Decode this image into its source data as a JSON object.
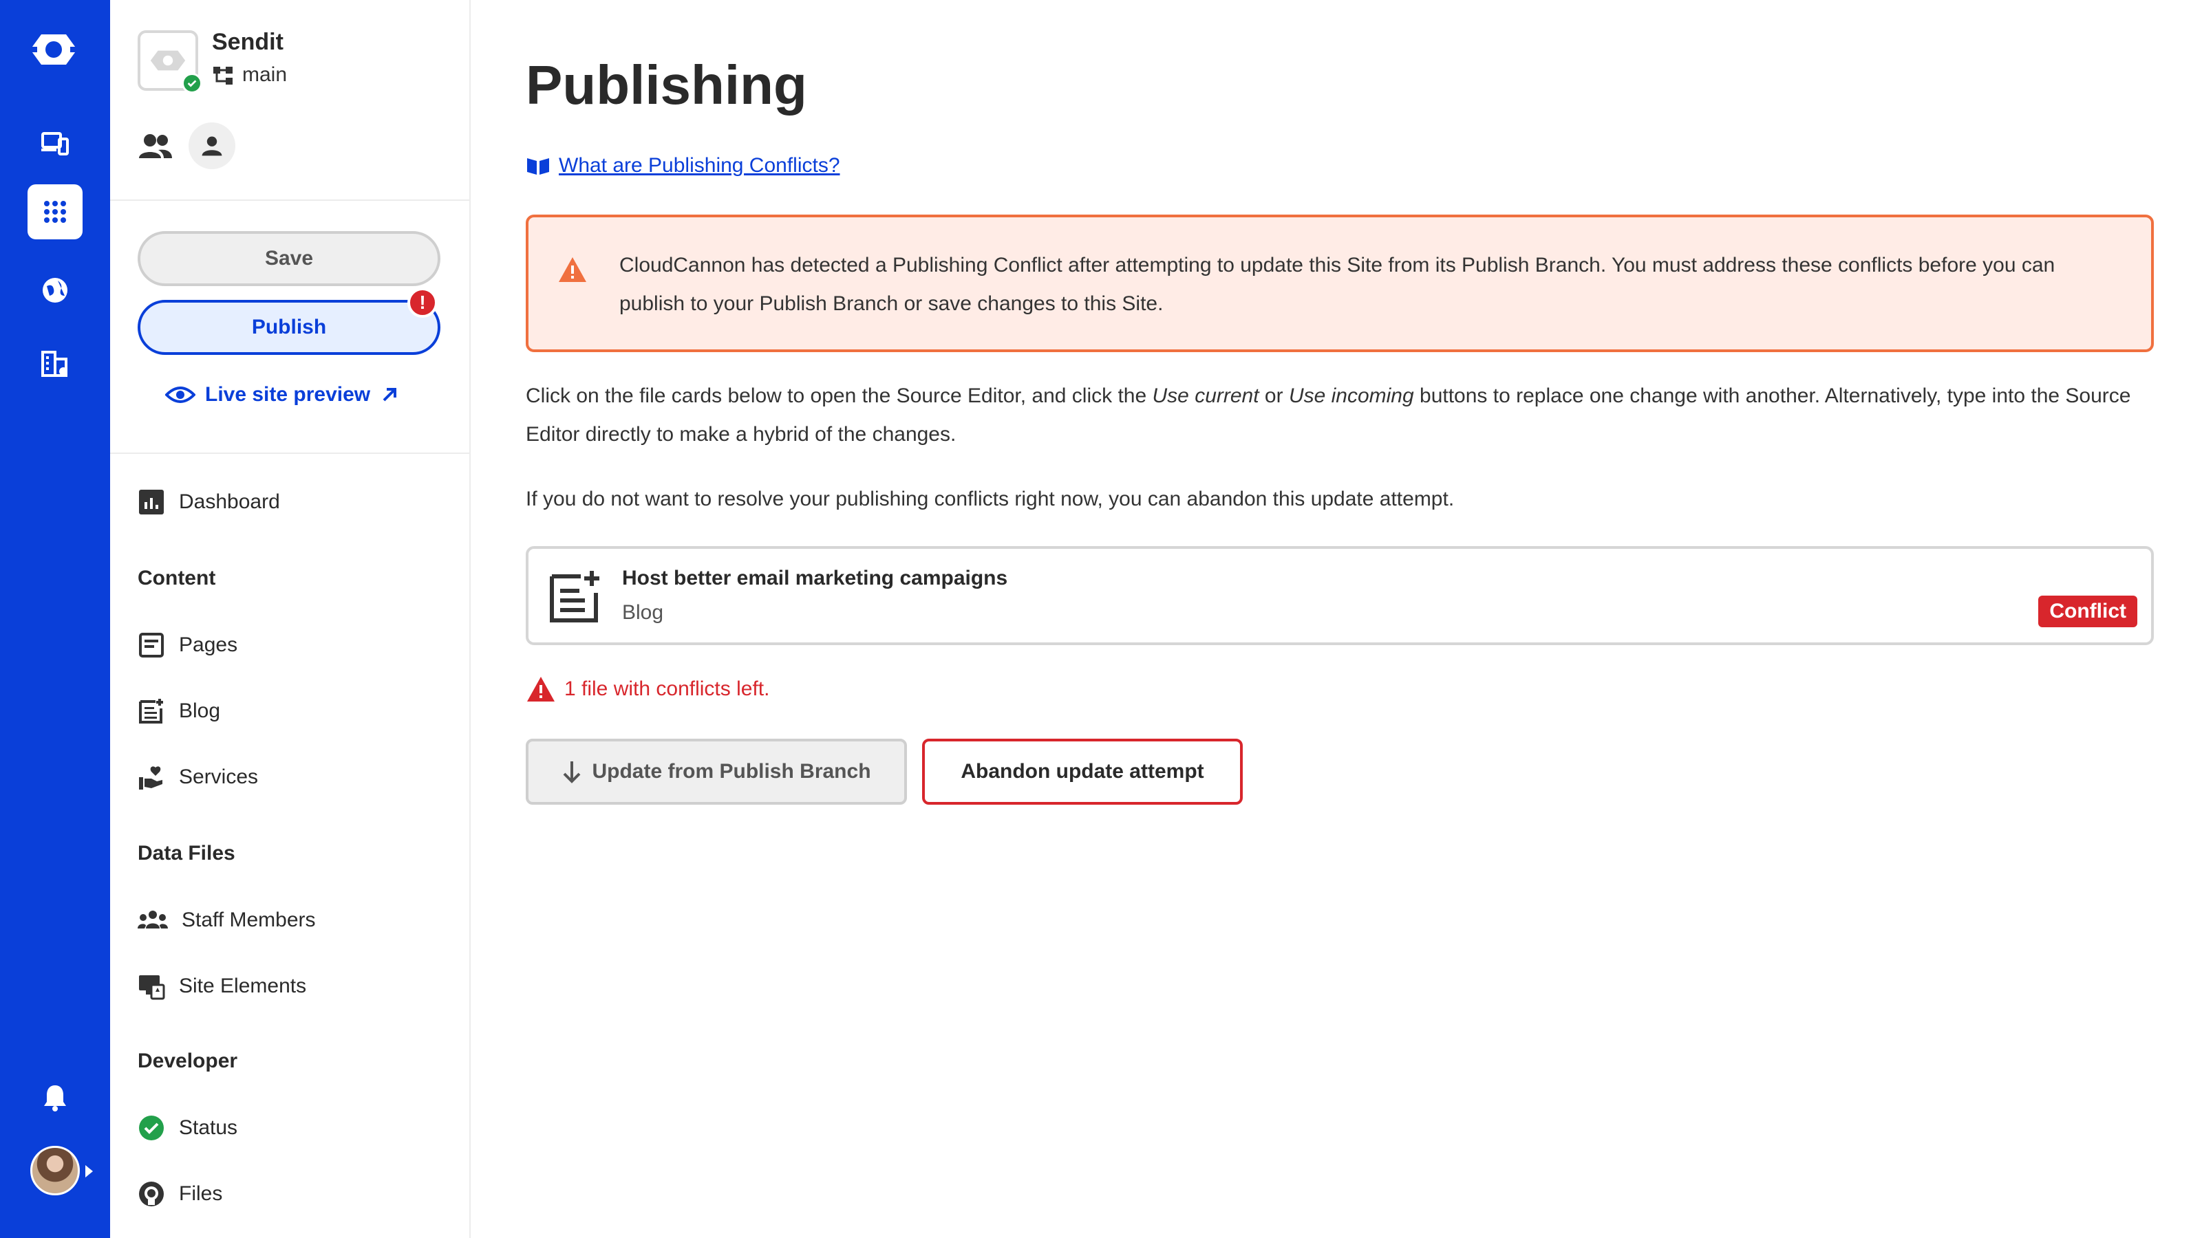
{
  "colors": {
    "rail": "#0a3fd9",
    "accent": "#0a3fd9",
    "danger": "#d8262c",
    "warning_border": "#f0703f",
    "warning_bg": "#ffece6",
    "success": "#22a04b"
  },
  "rail": {
    "icons": [
      "cloudcannon-logo-icon",
      "devices-icon",
      "apps-grid-icon",
      "globe-icon",
      "organization-icon",
      "bell-icon",
      "avatar"
    ]
  },
  "site": {
    "name": "Sendit",
    "branch": "main"
  },
  "sidebar": {
    "save_label": "Save",
    "publish_label": "Publish",
    "publish_badge": "!",
    "live_preview_label": "Live site preview",
    "dashboard": "Dashboard",
    "sections": {
      "content": {
        "title": "Content",
        "items": [
          "Pages",
          "Blog",
          "Services"
        ]
      },
      "data_files": {
        "title": "Data Files",
        "items": [
          "Staff Members",
          "Site Elements"
        ]
      },
      "developer": {
        "title": "Developer",
        "items": [
          "Status",
          "Files"
        ]
      }
    }
  },
  "main": {
    "title": "Publishing",
    "help_link": "What are Publishing Conflicts?",
    "alert_text": "CloudCannon has detected a Publishing Conflict after attempting to update this Site from its Publish Branch. You must address these conflicts before you can publish to your Publish Branch or save changes to this Site.",
    "para1": {
      "a": "Click on the file cards below to open the Source Editor, and click the ",
      "use_current": "Use current",
      "or": " or ",
      "use_incoming": "Use incoming",
      "b": " buttons to replace one change with another. Alternatively, type into the Source Editor directly to make a hybrid of the changes."
    },
    "para2": "If you do not want to resolve your publishing conflicts right now, you can abandon this update attempt.",
    "file_card": {
      "title": "Host better email marketing campaigns",
      "collection": "Blog",
      "status": "Conflict"
    },
    "conflicts_left": "1 file with conflicts left.",
    "update_button": "Update from Publish Branch",
    "abandon_button": "Abandon update attempt"
  }
}
